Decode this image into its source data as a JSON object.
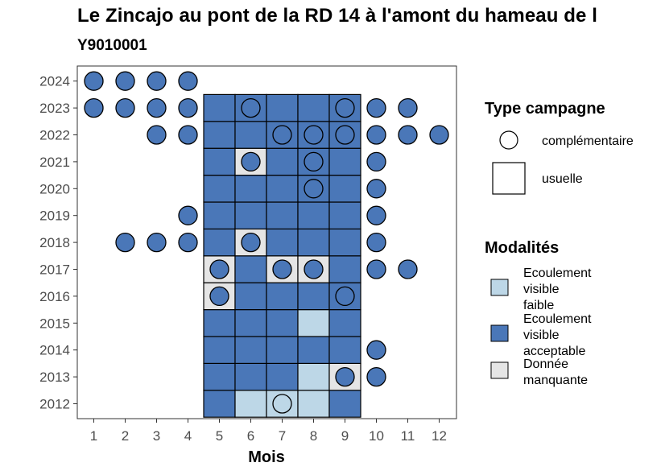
{
  "title": "Le Zincajo au pont de la RD 14 à l'amont du hameau de l",
  "subtitle": "Y9010001",
  "colors": {
    "faible": "#bdd7e7",
    "acceptable": "#4a77b8",
    "manquante": "#e5e5e5"
  },
  "chart_data": {
    "type": "heatmap",
    "xlabel": "Mois",
    "ylabel": "",
    "x_ticks": [
      "1",
      "2",
      "3",
      "4",
      "5",
      "6",
      "7",
      "8",
      "9",
      "10",
      "11",
      "12"
    ],
    "y_ticks": [
      "2012",
      "2013",
      "2014",
      "2015",
      "2016",
      "2017",
      "2018",
      "2019",
      "2020",
      "2021",
      "2022",
      "2023",
      "2024"
    ],
    "xlim": [
      0.5,
      12.5
    ],
    "ylim": [
      2011.5,
      2024.5
    ],
    "legend_type": {
      "title": "Type campagne",
      "items": [
        {
          "shape": "circle",
          "label": "complémentaire"
        },
        {
          "shape": "square",
          "label": "usuelle"
        }
      ]
    },
    "legend_modalites": {
      "title": "Modalités",
      "items": [
        {
          "key": "faible",
          "label_lines": [
            "Ecoulement",
            "visible",
            "faible"
          ]
        },
        {
          "key": "acceptable",
          "label_lines": [
            "Ecoulement",
            "visible",
            "acceptable"
          ]
        },
        {
          "key": "manquante",
          "label_lines": [
            "Donnée",
            "manquante"
          ]
        }
      ]
    },
    "usuelle": {
      "2023": {
        "5": "acceptable",
        "6": "acceptable",
        "7": "acceptable",
        "8": "acceptable",
        "9": "acceptable"
      },
      "2022": {
        "5": "acceptable",
        "6": "acceptable",
        "7": "acceptable",
        "8": "acceptable",
        "9": "acceptable"
      },
      "2021": {
        "5": "acceptable",
        "6": "manquante",
        "7": "acceptable",
        "8": "acceptable",
        "9": "acceptable"
      },
      "2020": {
        "5": "acceptable",
        "6": "acceptable",
        "7": "acceptable",
        "8": "acceptable",
        "9": "acceptable"
      },
      "2019": {
        "5": "acceptable",
        "6": "acceptable",
        "7": "acceptable",
        "8": "acceptable",
        "9": "acceptable"
      },
      "2018": {
        "5": "acceptable",
        "6": "manquante",
        "7": "acceptable",
        "8": "acceptable",
        "9": "acceptable"
      },
      "2017": {
        "5": "manquante",
        "6": "acceptable",
        "7": "manquante",
        "8": "manquante",
        "9": "acceptable"
      },
      "2016": {
        "5": "manquante",
        "6": "acceptable",
        "7": "acceptable",
        "8": "acceptable",
        "9": "acceptable"
      },
      "2015": {
        "5": "acceptable",
        "6": "acceptable",
        "7": "acceptable",
        "8": "faible",
        "9": "acceptable"
      },
      "2014": {
        "5": "acceptable",
        "6": "acceptable",
        "7": "acceptable",
        "8": "acceptable",
        "9": "acceptable"
      },
      "2013": {
        "5": "acceptable",
        "6": "acceptable",
        "7": "acceptable",
        "8": "faible",
        "9": "manquante"
      },
      "2012": {
        "5": "acceptable",
        "6": "faible",
        "7": "faible",
        "8": "faible",
        "9": "acceptable"
      }
    },
    "complementaire": {
      "2024": {
        "1": "acceptable",
        "2": "acceptable",
        "3": "acceptable",
        "4": "acceptable"
      },
      "2023": {
        "1": "acceptable",
        "2": "acceptable",
        "3": "acceptable",
        "4": "acceptable",
        "6": "acceptable",
        "9": "acceptable",
        "10": "acceptable",
        "11": "acceptable"
      },
      "2022": {
        "3": "acceptable",
        "4": "acceptable",
        "7": "acceptable",
        "8": "acceptable",
        "9": "acceptable",
        "10": "acceptable",
        "11": "acceptable",
        "12": "acceptable"
      },
      "2021": {
        "6": "acceptable",
        "8": "acceptable",
        "10": "acceptable"
      },
      "2020": {
        "8": "acceptable",
        "10": "acceptable"
      },
      "2019": {
        "4": "acceptable",
        "10": "acceptable"
      },
      "2018": {
        "2": "acceptable",
        "3": "acceptable",
        "4": "acceptable",
        "6": "acceptable",
        "10": "acceptable"
      },
      "2017": {
        "5": "acceptable",
        "7": "acceptable",
        "8": "acceptable",
        "10": "acceptable",
        "11": "acceptable"
      },
      "2016": {
        "5": "acceptable",
        "9": "acceptable"
      },
      "2014": {
        "10": "acceptable"
      },
      "2013": {
        "9": "acceptable",
        "10": "acceptable"
      },
      "2012": {
        "7": "faible"
      }
    }
  }
}
